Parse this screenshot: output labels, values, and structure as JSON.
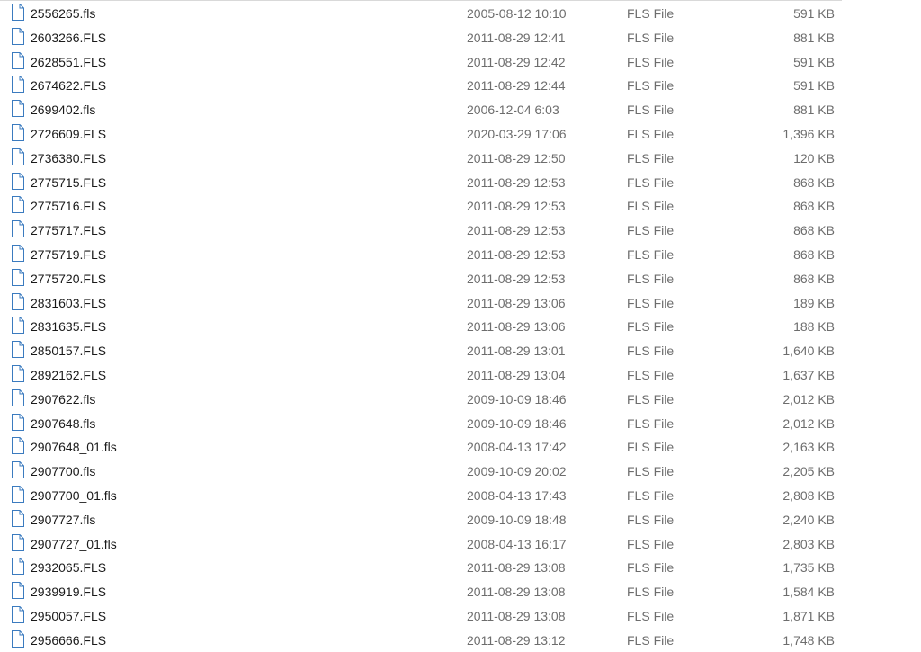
{
  "files": [
    {
      "name": "2556265.fls",
      "date": "2005-08-12 10:10",
      "type": "FLS File",
      "size": "591 KB"
    },
    {
      "name": "2603266.FLS",
      "date": "2011-08-29 12:41",
      "type": "FLS File",
      "size": "881 KB"
    },
    {
      "name": "2628551.FLS",
      "date": "2011-08-29 12:42",
      "type": "FLS File",
      "size": "591 KB"
    },
    {
      "name": "2674622.FLS",
      "date": "2011-08-29 12:44",
      "type": "FLS File",
      "size": "591 KB"
    },
    {
      "name": "2699402.fls",
      "date": "2006-12-04 6:03",
      "type": "FLS File",
      "size": "881 KB"
    },
    {
      "name": "2726609.FLS",
      "date": "2020-03-29 17:06",
      "type": "FLS File",
      "size": "1,396 KB"
    },
    {
      "name": "2736380.FLS",
      "date": "2011-08-29 12:50",
      "type": "FLS File",
      "size": "120 KB"
    },
    {
      "name": "2775715.FLS",
      "date": "2011-08-29 12:53",
      "type": "FLS File",
      "size": "868 KB"
    },
    {
      "name": "2775716.FLS",
      "date": "2011-08-29 12:53",
      "type": "FLS File",
      "size": "868 KB"
    },
    {
      "name": "2775717.FLS",
      "date": "2011-08-29 12:53",
      "type": "FLS File",
      "size": "868 KB"
    },
    {
      "name": "2775719.FLS",
      "date": "2011-08-29 12:53",
      "type": "FLS File",
      "size": "868 KB"
    },
    {
      "name": "2775720.FLS",
      "date": "2011-08-29 12:53",
      "type": "FLS File",
      "size": "868 KB"
    },
    {
      "name": "2831603.FLS",
      "date": "2011-08-29 13:06",
      "type": "FLS File",
      "size": "189 KB"
    },
    {
      "name": "2831635.FLS",
      "date": "2011-08-29 13:06",
      "type": "FLS File",
      "size": "188 KB"
    },
    {
      "name": "2850157.FLS",
      "date": "2011-08-29 13:01",
      "type": "FLS File",
      "size": "1,640 KB"
    },
    {
      "name": "2892162.FLS",
      "date": "2011-08-29 13:04",
      "type": "FLS File",
      "size": "1,637 KB"
    },
    {
      "name": "2907622.fls",
      "date": "2009-10-09 18:46",
      "type": "FLS File",
      "size": "2,012 KB"
    },
    {
      "name": "2907648.fls",
      "date": "2009-10-09 18:46",
      "type": "FLS File",
      "size": "2,012 KB"
    },
    {
      "name": "2907648_01.fls",
      "date": "2008-04-13 17:42",
      "type": "FLS File",
      "size": "2,163 KB"
    },
    {
      "name": "2907700.fls",
      "date": "2009-10-09 20:02",
      "type": "FLS File",
      "size": "2,205 KB"
    },
    {
      "name": "2907700_01.fls",
      "date": "2008-04-13 17:43",
      "type": "FLS File",
      "size": "2,808 KB"
    },
    {
      "name": "2907727.fls",
      "date": "2009-10-09 18:48",
      "type": "FLS File",
      "size": "2,240 KB"
    },
    {
      "name": "2907727_01.fls",
      "date": "2008-04-13 16:17",
      "type": "FLS File",
      "size": "2,803 KB"
    },
    {
      "name": "2932065.FLS",
      "date": "2011-08-29 13:08",
      "type": "FLS File",
      "size": "1,735 KB"
    },
    {
      "name": "2939919.FLS",
      "date": "2011-08-29 13:08",
      "type": "FLS File",
      "size": "1,584 KB"
    },
    {
      "name": "2950057.FLS",
      "date": "2011-08-29 13:08",
      "type": "FLS File",
      "size": "1,871 KB"
    },
    {
      "name": "2956666.FLS",
      "date": "2011-08-29 13:12",
      "type": "FLS File",
      "size": "1,748 KB"
    }
  ],
  "icon": "generic-file-icon",
  "colors": {
    "name_text": "#1a1a1a",
    "detail_text": "#6d6d6d",
    "icon_stroke": "#3b7bbf",
    "divider": "#d9d9d9"
  }
}
